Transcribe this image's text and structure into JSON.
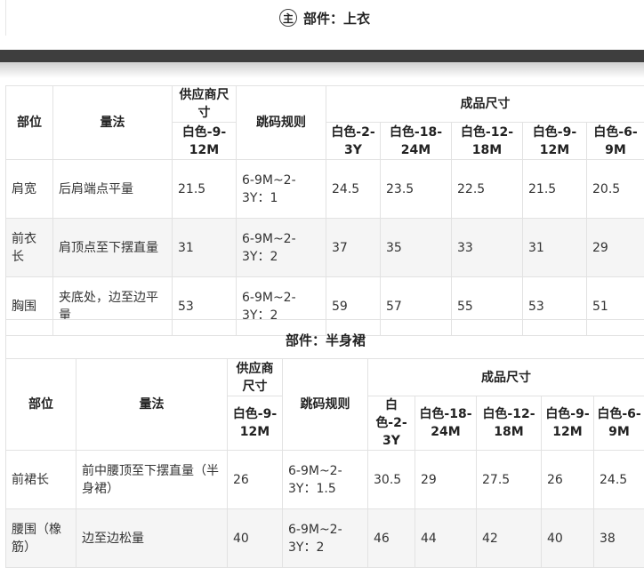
{
  "part1": {
    "badge": "主",
    "title": "部件：上衣",
    "headers": {
      "part": "部位",
      "method": "量法",
      "supplier": "供应商尺寸",
      "supplier_size": "白色-9-12M",
      "rule": "跳码规则",
      "finished": "成品尺寸",
      "sizes": [
        "白色-2-3Y",
        "白色-18-24M",
        "白色-12-18M",
        "白色-9-12M",
        "白色-6-9M"
      ]
    },
    "rows": [
      {
        "part": "肩宽",
        "method": "后肩端点平量",
        "supplier": "21.5",
        "rule": "6-9M~2-3Y：1",
        "values": [
          "24.5",
          "23.5",
          "22.5",
          "21.5",
          "20.5"
        ]
      },
      {
        "part": "前衣长",
        "method": "肩顶点至下摆直量",
        "supplier": "31",
        "rule": "6-9M~2-3Y：2",
        "values": [
          "37",
          "35",
          "33",
          "31",
          "29"
        ]
      },
      {
        "part": "胸围",
        "method": "夹底处，边至边平量",
        "supplier": "53",
        "rule": "6-9M~2-3Y：2",
        "values": [
          "59",
          "57",
          "55",
          "53",
          "51"
        ]
      }
    ]
  },
  "part2": {
    "title": "部件：半身裙",
    "headers": {
      "part": "部位",
      "method": "量法",
      "supplier": "供应商尺寸",
      "supplier_size": "白色-9-12M",
      "rule": "跳码规则",
      "finished": "成品尺寸",
      "sizes": [
        "白色-2-3Y",
        "白色-18-24M",
        "白色-12-18M",
        "白色-9-12M",
        "白色-6-9M"
      ]
    },
    "rows": [
      {
        "part": "前裙长",
        "method": "前中腰顶至下摆直量（半身裙）",
        "supplier": "26",
        "rule": "6-9M~2-3Y：1.5",
        "values": [
          "30.5",
          "29",
          "27.5",
          "26",
          "24.5"
        ]
      },
      {
        "part": "腰围（橡筋）",
        "method": "边至边松量",
        "supplier": "40",
        "rule": "6-9M~2-3Y：2",
        "values": [
          "46",
          "44",
          "42",
          "40",
          "38"
        ]
      }
    ]
  }
}
